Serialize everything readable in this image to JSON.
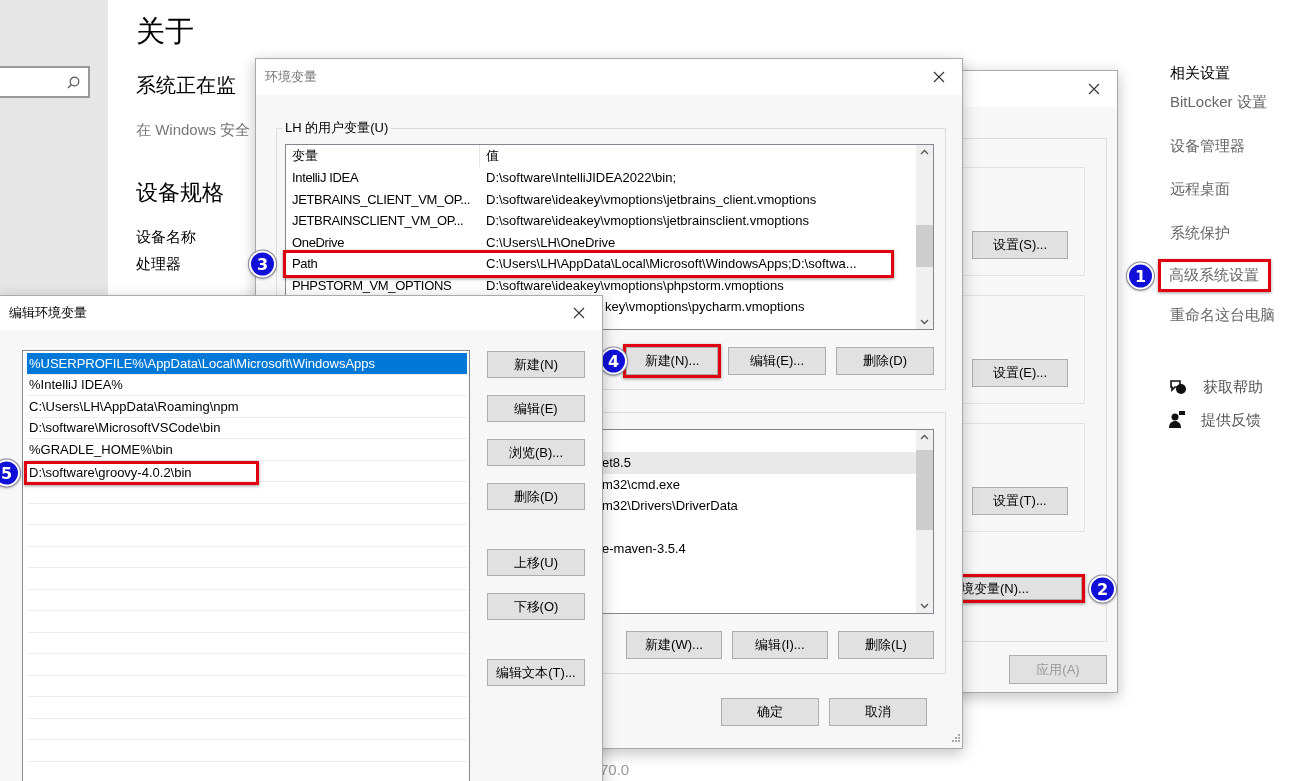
{
  "settings": {
    "title": "关于",
    "security_heading": "系统正在监",
    "security_text": "在 Windows 安全",
    "specs_heading": "设备规格",
    "spec_labels": [
      "设备名称",
      "处理器"
    ],
    "version_fragment": "70.0",
    "related": {
      "heading": "相关设置",
      "links": [
        {
          "label": "BitLocker 设置"
        },
        {
          "label": "设备管理器"
        },
        {
          "label": "远程桌面"
        },
        {
          "label": "系统保护"
        },
        {
          "label": "高级系统设置",
          "callout": "1"
        },
        {
          "label": "重命名这台电脑"
        }
      ],
      "support": [
        {
          "kind": "help",
          "label": "获取帮助"
        },
        {
          "kind": "feedback",
          "label": "提供反馈"
        }
      ]
    }
  },
  "system_properties": {
    "group_buttons": [
      "设置(S)...",
      "设置(E)...",
      "设置(T)..."
    ],
    "env_button": {
      "label": "境变量(N)...",
      "callout": "2"
    },
    "apply_button": {
      "label": "应用(A)",
      "disabled": true
    }
  },
  "env_window": {
    "title": "环境变量",
    "user_group": {
      "label": "LH 的用户变量(U)",
      "columns": [
        "变量",
        "值"
      ],
      "rows": [
        {
          "kind": "full",
          "name": "IntelliJ IDEA",
          "value": "D:\\software\\IntelliJIDEA2022\\bin;"
        },
        {
          "kind": "full",
          "name": "JETBRAINS_CLIENT_VM_OP...",
          "value": "D:\\software\\ideakey\\vmoptions\\jetbrains_client.vmoptions"
        },
        {
          "kind": "full",
          "name": "JETBRAINSCLIENT_VM_OP...",
          "value": "D:\\software\\ideakey\\vmoptions\\jetbrainsclient.vmoptions"
        },
        {
          "kind": "full",
          "name": "OneDrive",
          "value": "C:\\Users\\LH\\OneDrive"
        },
        {
          "kind": "full",
          "name": "Path",
          "value": "C:\\Users\\LH\\AppData\\Local\\Microsoft\\WindowsApps;D:\\softwa...",
          "callout": "3"
        },
        {
          "kind": "full",
          "name": "PHPSTORM_VM_OPTIONS",
          "value": "D:\\software\\ideakey\\vmoptions\\phpstorm.vmoptions"
        },
        {
          "kind": "partial",
          "value": "key\\vmoptions\\pycharm.vmoptions"
        }
      ],
      "buttons": [
        {
          "label": "新建(N)...",
          "callout": "4"
        },
        {
          "label": "编辑(E)..."
        },
        {
          "label": "删除(D)"
        }
      ]
    },
    "system_group": {
      "rows": [
        {
          "value": "et8.5",
          "selected": true
        },
        {
          "value": "m32\\cmd.exe",
          "selected": false
        },
        {
          "value": "m32\\Drivers\\DriverData",
          "selected": false
        },
        {
          "selected": false
        },
        {
          "value": "e-maven-3.5.4",
          "selected": false
        }
      ],
      "buttons": [
        {
          "label": "新建(W)..."
        },
        {
          "label": "编辑(I)..."
        },
        {
          "label": "删除(L)"
        }
      ]
    },
    "buttons": [
      "确定",
      "取消"
    ]
  },
  "edit_window": {
    "title": "编辑环境变量",
    "entries": [
      {
        "text": "%USERPROFILE%\\AppData\\Local\\Microsoft\\WindowsApps",
        "selected": true
      },
      {
        "text": "%IntelliJ IDEA%",
        "selected": false
      },
      {
        "text": "C:\\Users\\LH\\AppData\\Roaming\\npm",
        "selected": false
      },
      {
        "text": "D:\\software\\MicrosoftVSCode\\bin",
        "selected": false
      },
      {
        "text": "%GRADLE_HOME%\\bin",
        "selected": false
      },
      {
        "text": "D:\\software\\groovy-4.0.2\\bin",
        "selected": false,
        "callout": "5"
      }
    ],
    "button_groups": [
      [
        "新建(N)",
        "编辑(E)",
        "浏览(B)...",
        "删除(D)"
      ],
      [
        "上移(U)",
        "下移(O)"
      ],
      [
        "编辑文本(T)..."
      ]
    ]
  }
}
